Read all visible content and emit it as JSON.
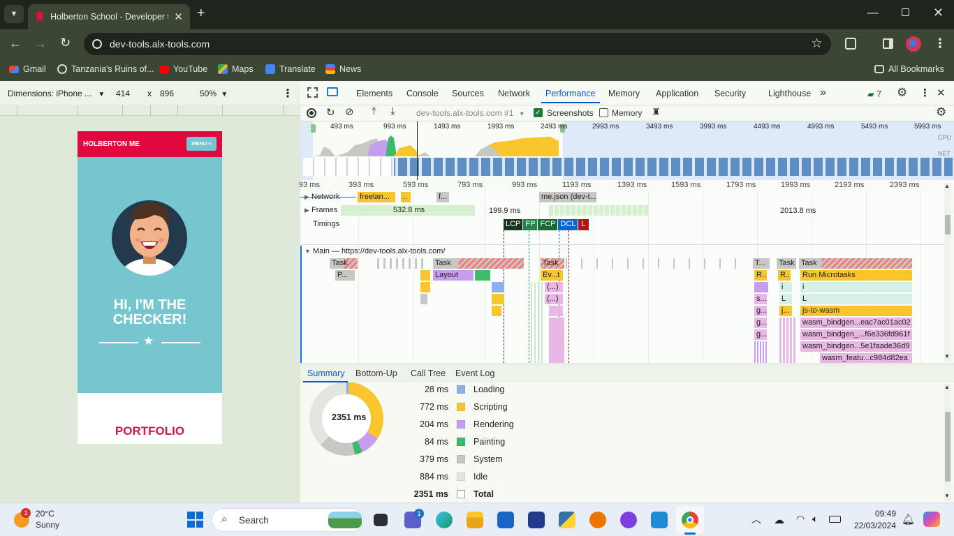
{
  "browser": {
    "tab_title": "Holberton School - Developer to",
    "url": "dev-tools.alx-tools.com",
    "bookmarks": [
      "Gmail",
      "Tanzania's Ruins of...",
      "YouTube",
      "Maps",
      "Translate",
      "News"
    ],
    "all_bookmarks": "All Bookmarks"
  },
  "device": {
    "dimensions_label": "Dimensions: iPhone ...",
    "width": "414",
    "times": "x",
    "height": "896",
    "zoom": "50%",
    "site_logo": "HOLBERTON ME",
    "menu_label": "MENU ≡",
    "hero_line1": "HI, I'M THE",
    "hero_line2": "CHECKER!",
    "portfolio": "PORTFOLIO"
  },
  "devtools": {
    "tabs": [
      "Elements",
      "Console",
      "Sources",
      "Network",
      "Performance",
      "Memory",
      "Application",
      "Security",
      "Lighthouse"
    ],
    "active_tab": "Performance",
    "more_tabs": "»",
    "issues_count": "7",
    "recording_select": "dev-tools.alx-tools.com #1",
    "screenshots_label": "Screenshots",
    "memory_label": "Memory",
    "overview_ticks": [
      "493 ms",
      "993 ms",
      "1493 ms",
      "1993 ms",
      "2493 ms",
      "2993 ms",
      "3493 ms",
      "3993 ms",
      "4493 ms",
      "4993 ms",
      "5493 ms",
      "5993 ms"
    ],
    "overview_cpu": "CPU",
    "overview_net": "NET",
    "ruler_ticks": [
      "93 ms",
      "393 ms",
      "593 ms",
      "793 ms",
      "993 ms",
      "1193 ms",
      "1393 ms",
      "1593 ms",
      "1793 ms",
      "1993 ms",
      "2193 ms",
      "2393 ms"
    ],
    "network_label": "Network",
    "network_items": [
      "freelan...",
      "..",
      "f...",
      "me.json (dev-t..."
    ],
    "frames_label": "Frames",
    "frames_values": [
      "532.8 ms",
      "199.9 ms",
      "2013.8 ms"
    ],
    "timings_label": "Timings",
    "timing_markers": [
      {
        "label": "LCP",
        "color": "#1a3422"
      },
      {
        "label": "FP",
        "color": "#228847"
      },
      {
        "label": "FCP",
        "color": "#1a6937"
      },
      {
        "label": "DCL",
        "color": "#0867cb"
      },
      {
        "label": "L",
        "color": "#b31412"
      }
    ],
    "main_label": "Main — https://dev-tools.alx-tools.com/",
    "flame": {
      "task": "Task",
      "t_short": "T...",
      "p_short": "P...",
      "layout": "Layout",
      "ev": "Ev...t",
      "anon": "(...)",
      "run_microtasks": "Run Microtasks",
      "r_short": "R...",
      "i_short": "i",
      "l_short": "L",
      "s_short": "s...",
      "g_short": "g...",
      "j_short": "j...",
      "js_to_wasm": "js-to-wasm",
      "wasm1": "wasm_bindgen...eac7ac01ac02",
      "wasm2": "wasm_bindgen_...f6e336fd961f",
      "wasm3": "wasm_bindgen...5e1faade36d9",
      "wasm4": "wasm_featu...c984d82ea"
    },
    "bottom_tabs": [
      "Summary",
      "Bottom-Up",
      "Call Tree",
      "Event Log"
    ],
    "active_bottom_tab": "Summary"
  },
  "summary": {
    "total_label_center": "2351 ms",
    "rows": [
      {
        "value": "28 ms",
        "label": "Loading",
        "color": "#8cb0e8"
      },
      {
        "value": "772 ms",
        "label": "Scripting",
        "color": "#f8c52c"
      },
      {
        "value": "204 ms",
        "label": "Rendering",
        "color": "#c79df0"
      },
      {
        "value": "84 ms",
        "label": "Painting",
        "color": "#3dba6a"
      },
      {
        "value": "379 ms",
        "label": "System",
        "color": "#c7c8c4"
      },
      {
        "value": "884 ms",
        "label": "Idle",
        "color": "#e3e5df"
      }
    ],
    "total": {
      "value": "2351 ms",
      "label": "Total"
    }
  },
  "taskbar": {
    "weather_temp": "20°C",
    "weather_desc": "Sunny",
    "weather_badge": "1",
    "search": "Search",
    "teams_badge": "1",
    "time": "09:49",
    "date": "22/03/2024"
  }
}
